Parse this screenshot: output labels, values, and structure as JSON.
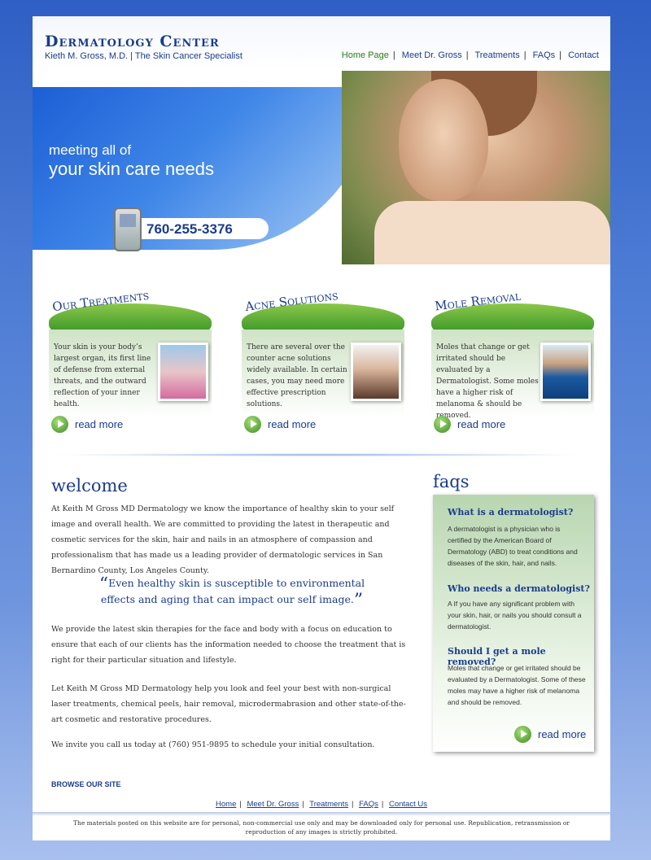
{
  "header": {
    "title": "Dermatology Center",
    "subtitle": "Kieth M. Gross, M.D. |  The Skin Cancer Specialist",
    "nav": [
      "Home Page",
      "Meet Dr. Gross",
      "Treatments",
      "FAQs",
      "Contact"
    ]
  },
  "hero": {
    "line1": "meeting all of",
    "line2": "your skin care needs",
    "phone": "760-255-3376"
  },
  "panels": [
    {
      "title": "Our Treatments",
      "text": "Your skin is your body’s largest organ, its first line of defense from external threats, and the outward reflection of your inner health.",
      "readmore": "read more"
    },
    {
      "title": "Acne Solutions",
      "text": "There are several over the counter acne solutions widely available.  In certain cases, you may need more effective prescription solutions.",
      "readmore": "read more"
    },
    {
      "title": "Mole Removal",
      "text": "Moles that change or get irritated should be evaluated by a Dermatologist.  Some moles have a higher risk of melanoma & should be removed.",
      "readmore": "read more"
    }
  ],
  "welcome": {
    "title": "welcome",
    "p1": "At Keith M Gross MD Dermatology we know the importance of healthy skin to your self image and overall health.  We are committed to providing the latest in therapeutic and cosmetic services for the skin, hair and nails in an atmosphere of compassion and professionalism that has made us a leading provider of dermatologic services in San Bernardino County, Los Angeles County.",
    "quote": "Even healthy skin is susceptible to environmental effects and aging that can impact our self image.",
    "p2": "We provide the latest skin therapies for the face and body with a focus on education to ensure that each of our clients has the information needed to choose the treatment that is right for their particular situation and lifestyle.",
    "p3": "Let Keith M Gross MD Dermatology help you look and feel your best with non-surgical laser treatments, chemical peels, hair removal, microdermabrasion and other state-of-the-art cosmetic and restorative procedures.",
    "p4": "We invite you call us today at (760) 951-9895 to schedule your initial consultation."
  },
  "faqs": {
    "title": "faqs",
    "items": [
      {
        "q": "What is a dermatologist?",
        "a": "A dermatologist is a physician who is certified by the American Board of Dermatology (ABD) to treat conditions and diseases of the skin, hair, and nails."
      },
      {
        "q": "Who needs a dermatologist?",
        "a": "A If you have any significant problem with your skin, hair, or nails you should consult a dermatologist."
      },
      {
        "q": "Should I get a mole removed?",
        "a": "Moles that change or get irritated should be evaluated by a Dermatologist.  Some of these moles may have a higher risk of melanoma and should be removed."
      }
    ],
    "readmore": "read more"
  },
  "footer": {
    "browse": "BROWSE OUR SITE",
    "nav": [
      "Home",
      "Meet Dr. Gross",
      "Treatments",
      "FAQs",
      "Contact Us"
    ],
    "legal": "The materials posted on this website are for personal, non-commercial use only and may be downloaded only for personal use. Republication, retransmission or reproduction of any images is strictly prohibited."
  }
}
